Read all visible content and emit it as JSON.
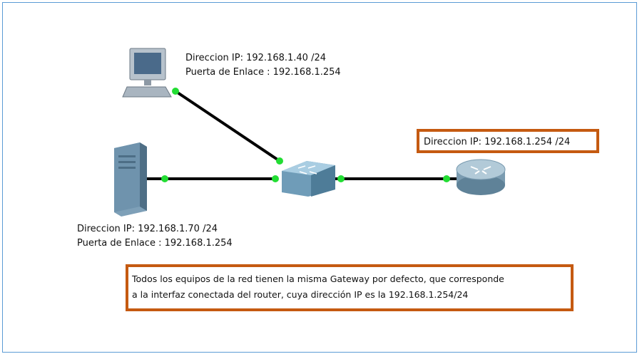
{
  "pc": {
    "ip_line": "Direccion IP: 192.168.1.40 /24",
    "gateway_line": "Puerta de Enlace : 192.168.1.254"
  },
  "server": {
    "ip_line": "Direccion IP: 192.168.1.70 /24",
    "gateway_line": "Puerta de Enlace : 192.168.1.254"
  },
  "router": {
    "ip_line": "Direccion IP: 192.168.1.254 /24"
  },
  "note": {
    "line1": "Todos los equipos de la red tienen la misma Gateway por defecto, que corresponde",
    "line2": "a la interfaz conectada del router, cuya dirección IP es la 192.168.1.254/24"
  },
  "colors": {
    "link": "#000000",
    "port": "#22dd33",
    "highlight_border": "#c55a11",
    "frame_border": "#5b9bd5"
  },
  "icons": [
    "pc-icon",
    "server-icon",
    "switch-icon",
    "router-icon"
  ]
}
